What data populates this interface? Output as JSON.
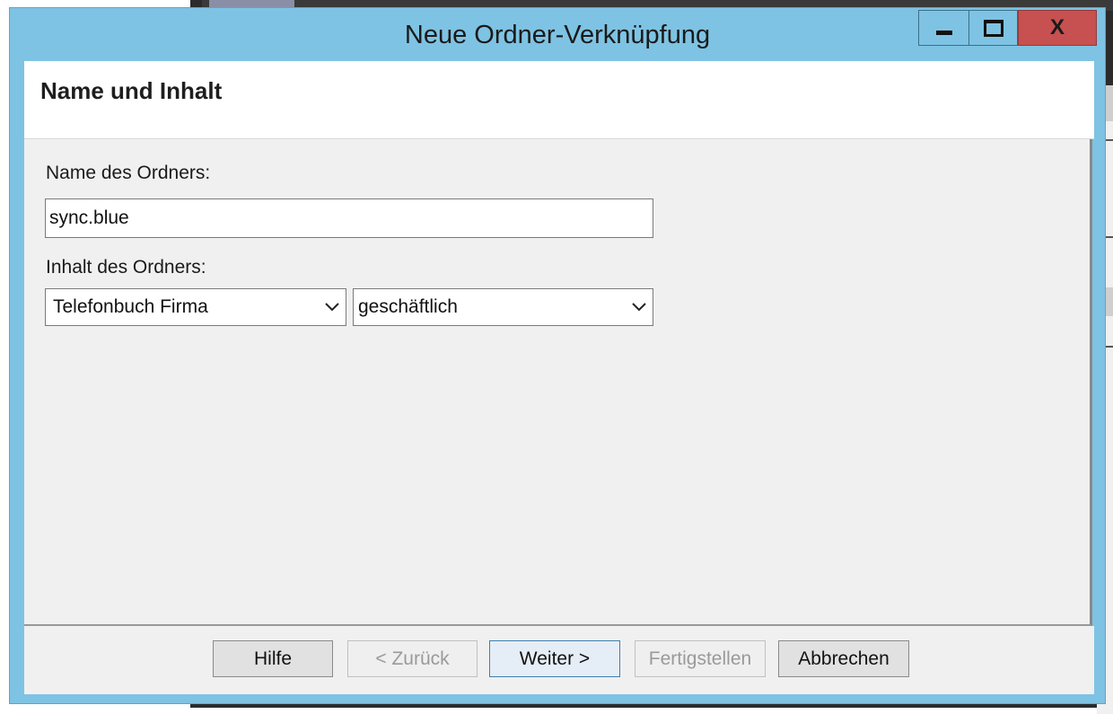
{
  "window": {
    "title": "Neue Ordner-Verknüpfung",
    "close_glyph": "X"
  },
  "header": {
    "title": "Name und Inhalt"
  },
  "form": {
    "name_label": "Name des Ordners:",
    "name_value": "sync.blue",
    "content_label": "Inhalt des Ordners:",
    "content_type_selected": "Telefonbuch Firma",
    "category_selected": "geschäftlich"
  },
  "buttons": {
    "help": "Hilfe",
    "back": "< Zurück",
    "next": "Weiter >",
    "finish": "Fertigstellen",
    "cancel": "Abbrechen"
  },
  "colors": {
    "title_bar": "#7ec3e3",
    "close_button": "#c75050"
  },
  "icons": {
    "minimize": "minimize-icon",
    "maximize": "maximize-icon",
    "close": "close-icon",
    "dropdown": "chevron-down-icon"
  }
}
